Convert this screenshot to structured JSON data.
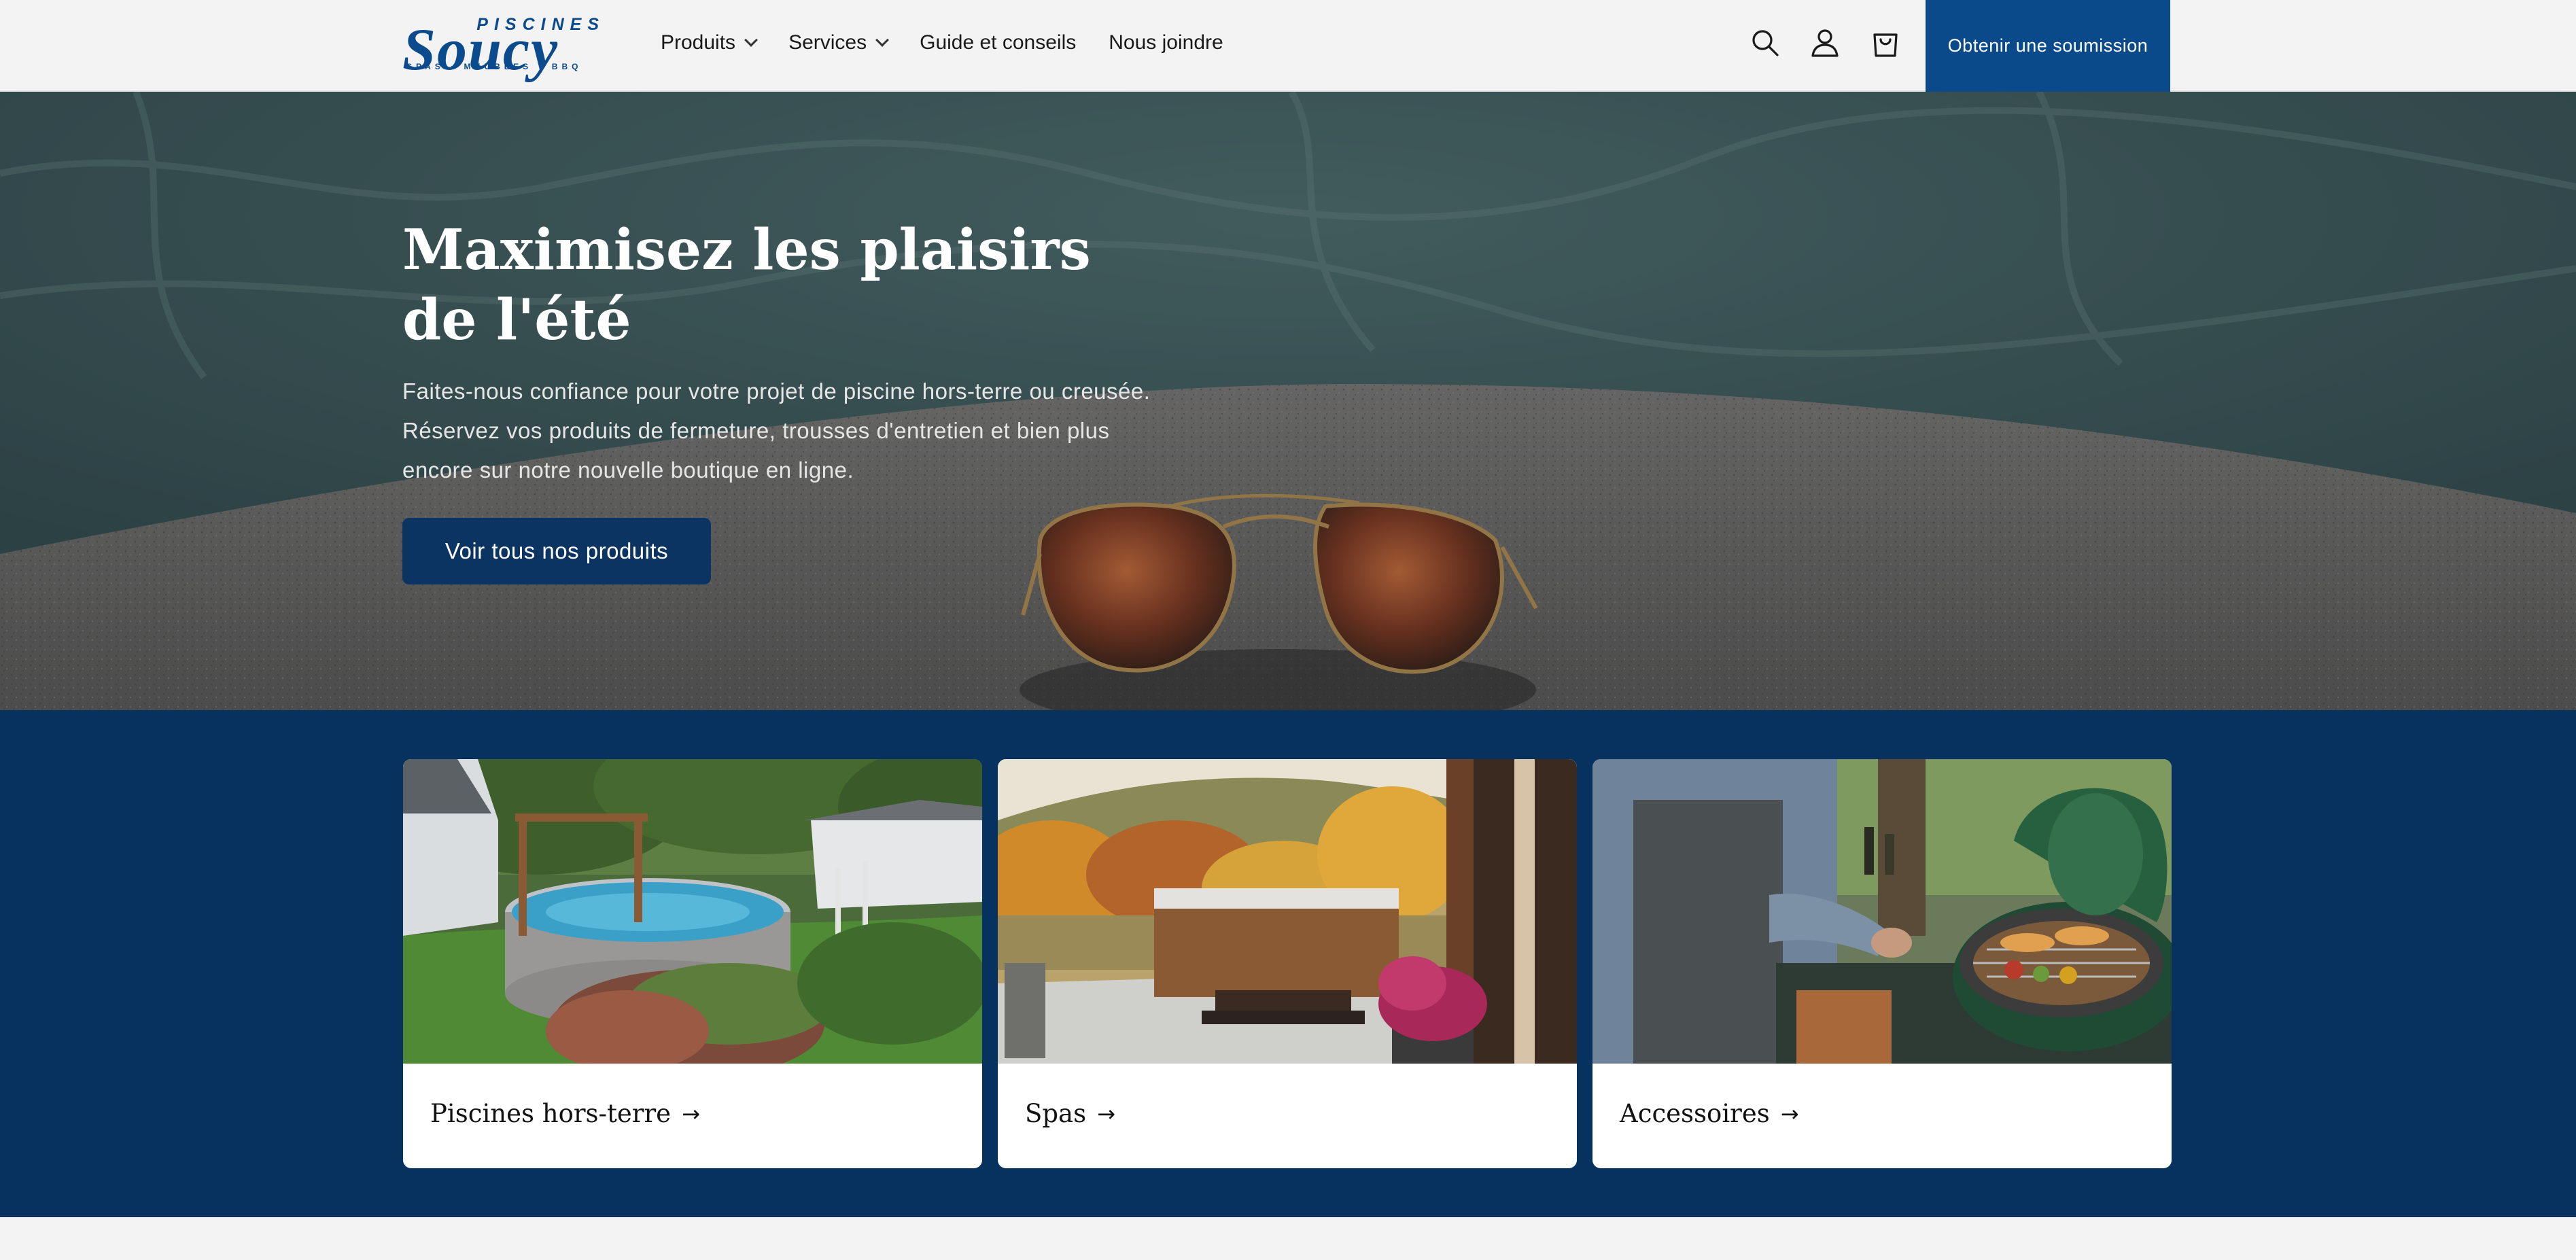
{
  "header": {
    "logo": {
      "top": "PISCINES",
      "main": "Soucy",
      "sub": "SPAS · MEUBLES · BBQ"
    },
    "nav": [
      {
        "label": "Produits",
        "has_dropdown": true
      },
      {
        "label": "Services",
        "has_dropdown": true
      },
      {
        "label": "Guide et conseils",
        "has_dropdown": false
      },
      {
        "label": "Nous joindre",
        "has_dropdown": false
      }
    ],
    "icons": [
      "search-icon",
      "account-icon",
      "cart-icon"
    ],
    "quote_button": "Obtenir une soumission"
  },
  "hero": {
    "title": "Maximisez les plaisirs de l'été",
    "text": "Faites-nous confiance pour votre projet de piscine hors-terre ou creusée. Réservez vos produits de fermeture, trousses d'entretien et bien plus encore sur notre nouvelle boutique en ligne.",
    "button": "Voir tous nos produits"
  },
  "categories": [
    {
      "label": "Piscines hors-terre",
      "arrow": "→"
    },
    {
      "label": "Spas",
      "arrow": "→"
    },
    {
      "label": "Accessoires",
      "arrow": "→"
    }
  ],
  "colors": {
    "brand_blue": "#0a4a8b",
    "navy": "#07325f",
    "hero_button": "#0b3463",
    "header_bg": "#f3f3f3"
  }
}
